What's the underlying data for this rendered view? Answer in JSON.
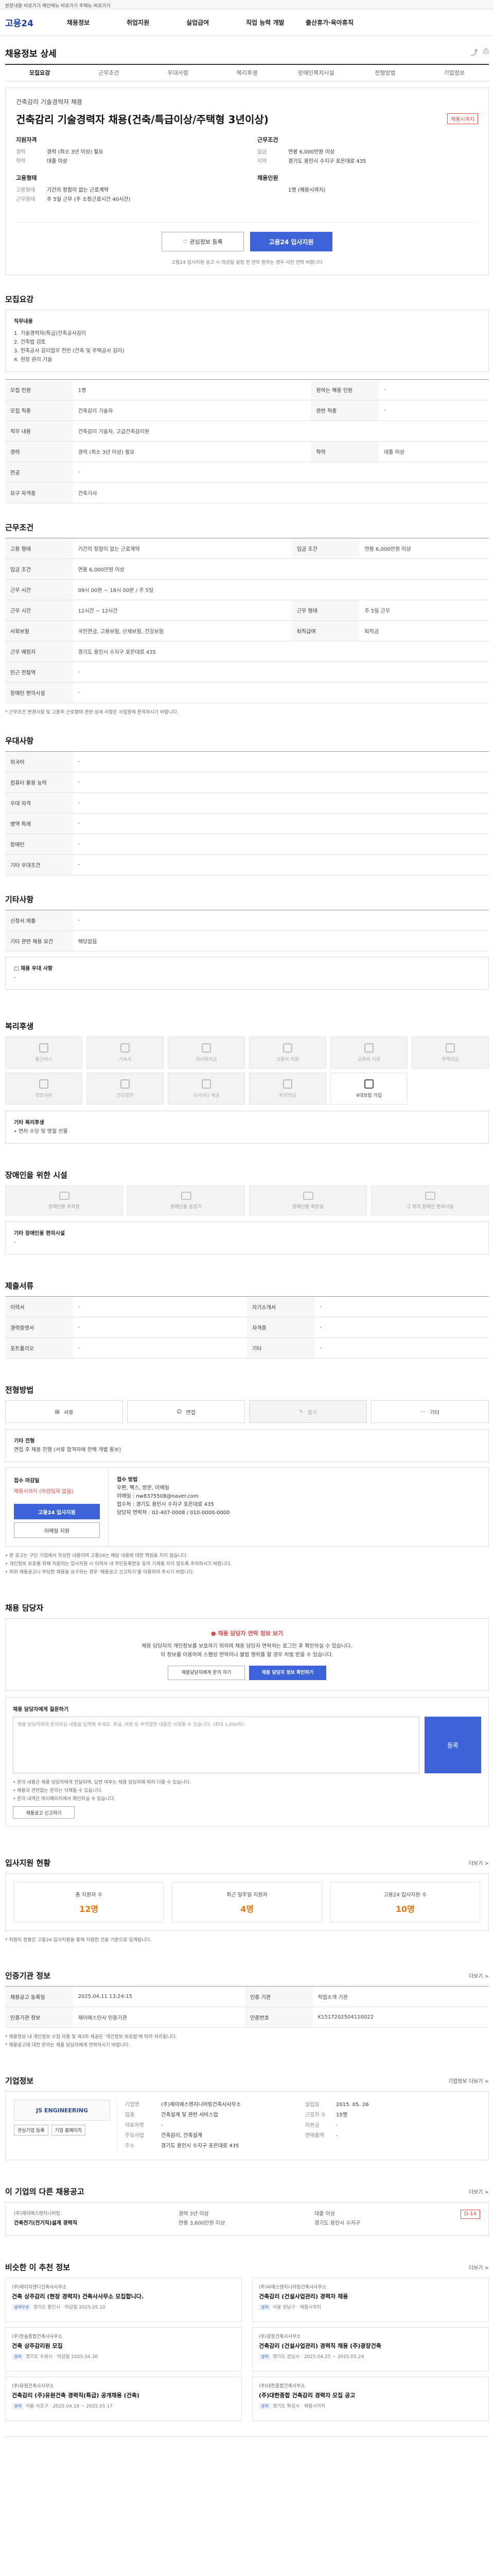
{
  "skip_link": "본문내용 바로가기  메인메뉴 바로가기  주메뉴 바로가기",
  "brand": {
    "logo": "고용24"
  },
  "gnb": [
    "채용정보",
    "취업지원",
    "실업급여",
    "직업 능력 개발",
    "출산휴가·육아휴직"
  ],
  "page_title": "채용정보 상세",
  "tabs": [
    "모집요강",
    "근무조건",
    "우대사항",
    "복리후생",
    "장애인복지시설",
    "전형방법",
    "기업정보"
  ],
  "head": {
    "org": "건축감리 기술경력자 채용",
    "title": "건축감리 기술경력자 채용(건축/특급이상/주택형 3년이상)",
    "badge": "채용시까지",
    "blocks": [
      {
        "h": "지원자격",
        "rows": [
          [
            "경력",
            "경력 (최소 3년 이상) 필요"
          ],
          [
            "학력",
            "대졸 이상"
          ]
        ]
      },
      {
        "h": "근무조건",
        "rows": [
          [
            "임금",
            "연봉 6,000만원 이상"
          ],
          [
            "지역",
            "경기도 용인시 수지구 포은대로 435"
          ]
        ]
      },
      {
        "h": "고용형태",
        "rows": [
          [
            "고용형태",
            "기간의 정함이 없는 근로계약"
          ],
          [
            "근무형태",
            "주 5일 근무 (주 소정근로시간 40시간)"
          ]
        ]
      },
      {
        "h": "채용인원",
        "rows": [
          [
            "",
            "1명 (채용시까지)"
          ]
        ]
      }
    ],
    "btn_save": "관심정보 등록",
    "btn_apply": "고용24 입사지원",
    "note": "고용24 입사지원 공고 시 마감일 설정 전 연락 원하는 경우 사전 연락 바랍니다"
  },
  "recruit": {
    "title": "모집요강",
    "duty_head": "직무내용",
    "duty_lines": [
      "1. 기술경력자(특급)건축공사감리",
      "2. 건축법 검토",
      "3. 전축공사 감리업무 전반 (건축 및 주택공사 감리)",
      "4. 현장 관리 기술"
    ],
    "rows": [
      [
        "모집 인원",
        "1명",
        "원하는 채용 인원",
        "-"
      ],
      [
        "모집 직종",
        "건축감리 기술자",
        "관련 직종",
        "-"
      ],
      [
        "직무 내용",
        "건축감리 기술자, 고급건축감리원",
        "",
        ""
      ],
      [
        "경력",
        "경력 (최소 3년 이상) 필요",
        "학력",
        "대졸 이상"
      ],
      [
        "전공",
        "-",
        "",
        ""
      ],
      [
        "요구 자격증",
        "건축기사",
        "",
        ""
      ]
    ]
  },
  "work": {
    "title": "근무조건",
    "rows": [
      [
        "고용 형태",
        "기간의 정함이 없는 근로계약",
        "임금 조건",
        "연봉 6,000만원 이상"
      ],
      [
        "임금 조건",
        "연봉 6,000만원 이상",
        "",
        ""
      ],
      [
        "근무 시간",
        "09시 00분 ~ 18시 00분 / 주 5일",
        "",
        ""
      ],
      [
        "근무 시간",
        "12시간 ~ 12시간",
        "근무 형태",
        "주 5일 근무"
      ],
      [
        "사회보험",
        "국민연금, 고용보험, 산재보험, 건강보험",
        "퇴직급여",
        "퇴직금"
      ],
      [
        "근무 예정지",
        "경기도 용인시 수지구 포은대로 435",
        "",
        ""
      ],
      [
        "인근 전철역",
        "-",
        "",
        ""
      ],
      [
        "장애인 편의시설",
        "-",
        "",
        ""
      ]
    ],
    "note": "* 근무조건 변경사항 및 고용주 근로형태 관련 상세 사항은 사업장에 문의하시기 바랍니다."
  },
  "prefer": {
    "title": "우대사항",
    "rows": [
      [
        "외국어",
        "-"
      ],
      [
        "컴퓨터 활용 능력",
        "-"
      ],
      [
        "우대 자격",
        "-"
      ],
      [
        "병역 특례",
        "-"
      ],
      [
        "장애인",
        "-"
      ],
      [
        "기타 우대조건",
        "-"
      ]
    ]
  },
  "extra": {
    "title": "기타사항",
    "rows": [
      [
        "신청서 제출",
        "-"
      ],
      [
        "기타 관련 채용 요건",
        "해당없음"
      ]
    ],
    "sub_head": "□ 채용 우대 사항",
    "sub_body": "-"
  },
  "welfare": {
    "title": "복리후생",
    "items": [
      {
        "label": "통근버스",
        "on": false
      },
      {
        "label": "기숙사",
        "on": false
      },
      {
        "label": "자녀학자금",
        "on": false
      },
      {
        "label": "교통비 지원",
        "on": false
      },
      {
        "label": "교육비 지원",
        "on": false
      },
      {
        "label": "주택자금",
        "on": false
      },
      {
        "label": "경조사비",
        "on": false
      },
      {
        "label": "건강검진",
        "on": false
      },
      {
        "label": "식사(비) 제공",
        "on": false
      },
      {
        "label": "퇴직연금",
        "on": false
      },
      {
        "label": "4대보험 가입",
        "on": true
      }
    ],
    "etc_head": "기타 복리후생",
    "etc_body": "• 연차 수당 및 명절 선물"
  },
  "disabled": {
    "title": "장애인을 위한 시설",
    "items": [
      "장애인용 주차장",
      "장애인용 승강기",
      "장애인용 화장실",
      "그 밖의 장애인 편의시설"
    ],
    "etc_head": "기타 장애인용 편의시설",
    "etc_body": "-"
  },
  "apply_doc": {
    "title": "제출서류",
    "rows": [
      [
        "이력서",
        "-",
        "자기소개서",
        "-"
      ],
      [
        "경력증명서",
        "-",
        "자격증",
        "-"
      ],
      [
        "포트폴리오",
        "-",
        "기타",
        "-"
      ]
    ]
  },
  "method": {
    "title": "전형방법",
    "items": [
      {
        "label": "서류",
        "on": true
      },
      {
        "label": "면접",
        "on": true
      },
      {
        "label": "필기",
        "on": false
      },
      {
        "label": "기타",
        "on": true
      }
    ],
    "etc_head": "기타 전형",
    "etc_body": "면접 후 채용 진행 (서류 합격자에 한해 개별 통보)",
    "left_head": "접수 마감일",
    "left_date": "채용시까지 (마감일자 없음)",
    "left_btn": "고용24 입사지원",
    "left_btn2": "이메일 지원",
    "right_head": "접수 방법",
    "right_lines": [
      "우편, 팩스, 방문, 이메일",
      "이메일 : nw8375508@naver.com",
      "접수처 : 경기도 용인시 수지구 포은대로 435",
      "담당자 연락처 : 02-407-0008 / 010-0000-0000"
    ],
    "bullets": [
      "• 본 공고는 구인 기업에서 작성한 내용이며 고용24는 해당 내용에 대한 책임을 지지 않습니다.",
      "• 개인정보 보호를 위해 지원자는 입사지원 시 이력서 내 주민등록번호 등의 기재를 하지 않도록 주의하시기 바랍니다.",
      "• 허위 채용공고나 부당한 채용을 요구하는 경우 '채용공고 신고하기'를 이용하여 주시기 바랍니다."
    ]
  },
  "contact": {
    "title": "채용 담당자",
    "warn": "채용 담당자 연락 정보 보기",
    "body1": "채용 담당자의 개인정보를 보호하기 위하여 채용 담당자 연락처는 로그인 후 확인하실 수 있습니다.",
    "body2": "이 정보를 이용하여 스팸성 연락이나 불법 행위를 할 경우 처벌 받을 수 있습니다.",
    "btn1": "채용담당자에게 문의 하기",
    "btn2": "채용 담당자 정보 확인하기",
    "ask_head": "채용 담당자에게 질문하기",
    "ask_ph": "채용 담당자에게 문의하실 내용을 입력해 주세요. 욕설, 비방 등 부적절한 내용은 삭제될 수 있습니다. (최대 1,000자)",
    "ask_btn": "등록",
    "bullets": [
      "• 문의 내용은 채용 담당자에게 전달되며, 답변 여부는 채용 담당자에 따라 다를 수 있습니다.",
      "• 채용과 관련없는 문의는 삭제될 수 있습니다.",
      "• 문의 내역은 마이페이지에서 확인하실 수 있습니다."
    ],
    "report_btn": "채용공고 신고하기"
  },
  "stats": {
    "title": "입사지원 현황",
    "more": "더보기 >",
    "items": [
      {
        "label": "총 지원자 수",
        "n": "12명"
      },
      {
        "label": "최근 일주일 지원자",
        "n": "4명"
      },
      {
        "label": "고용24 입사지원 수",
        "n": "10명"
      }
    ],
    "note": "* 지원자 현황은 고용24 입사지원을 통해 지원한 건을 기준으로 집계됩니다."
  },
  "manage": {
    "title": "인증기관 정보",
    "more": "더보기 >",
    "rows": [
      [
        "채용공고 등록일",
        "2025.04.11 13:24:15",
        "인증 기관",
        "직업소개 기관"
      ],
      [
        "인증기관 정보",
        "제이에스인사 인증기관",
        "인증번호",
        "K1517202504110022"
      ]
    ],
    "bullets": [
      "* 채용정보 내 개인정보 수집 이용 및 제3자 제공은 '개인정보 보호법'에 따라 처리됩니다.",
      "* 채용공고에 대한 문의는 채용 담당자에게 연락하시기 바랍니다."
    ]
  },
  "company": {
    "title": "기업정보",
    "more": "기업정보 더보기 >",
    "logo": "JS ENGINEERING",
    "btn1": "관심기업 등록",
    "btn2": "기업 홈페이지",
    "rows": [
      [
        "기업명",
        "(주)제이에스엔지니어링건축사사무소",
        "설립일",
        "2015. 05. 26"
      ],
      [
        "업종",
        "건축설계 및 관련 서비스업",
        "근로자 수",
        "15명"
      ],
      [
        "대표자명",
        "-",
        "자본금",
        "-"
      ],
      [
        "주요사업",
        "건축감리, 건축설계",
        "연매출액",
        "-"
      ],
      [
        "주소",
        "경기도 용인시 수지구 포은대로 435",
        "",
        ""
      ]
    ]
  },
  "other": {
    "title": "이 기업의 다른 채용공고",
    "more": "더보기 >",
    "co": "(주)제이에스엔지니어링",
    "job": "건축전기(전기직)설계 경력직",
    "details": [
      "경력 3년 이상",
      "대졸 이상",
      "연봉 3,600만원 이상",
      "경기도 용인시 수지구"
    ],
    "badge": "D-14"
  },
  "recommend": {
    "title": "비슷한 이 추천 정보",
    "more": "더보기 >",
    "cards": [
      {
        "co": "(주)에이치엔디건축사사무소",
        "title": "건축 상주감리 (현장 경력자) 건축사사무소 모집합니다.",
        "tag": "경력무관",
        "meta": "경기도 용인시 · 마감일 2025.05.10"
      },
      {
        "co": "(주)씨에스엔지니어링건축사사무소",
        "title": "건축감리 (건설사업관리) 경력자 채용",
        "tag": "경력",
        "meta": "서울 강남구 · 채용시까지"
      },
      {
        "co": "(주)한솔종합건축사사무소",
        "title": "건축 상주감리원 모집",
        "tag": "경력",
        "meta": "경기도 수원시 · 마감일 2025.04.30"
      },
      {
        "co": "(주)광장건축사사무소",
        "title": "건축감리 (건설사업관리) 경력직 채용 (주)광장건축",
        "tag": "경력",
        "meta": "경기도 성남시 · 2025.04.25 ~ 2025.05.24"
      },
      {
        "co": "(주)유원건축사사무소",
        "title": "건축감리 (주)유원건축 경력직(특급) 공개채용 (건축)",
        "tag": "경력",
        "meta": "서울 서초구 · 2025.04.18 ~ 2025.05.17"
      },
      {
        "co": "(주)대한종합건축사무소",
        "title": "(주)대한종합 건축감리 경력자 모집 공고",
        "tag": "경력",
        "meta": "경기도 화성시 · 채용시까지"
      }
    ]
  }
}
